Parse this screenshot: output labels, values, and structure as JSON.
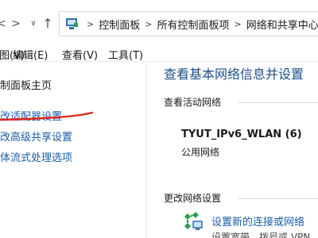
{
  "address_bar": {
    "nav": [
      "back-arrow",
      "forward-arrow",
      "dropdown",
      "up-arrow"
    ],
    "location_icon": "control-panel-icon",
    "breadcrumbs": [
      "控制面板",
      "所有控制面板项",
      "网络和共享中心"
    ]
  },
  "menubar": {
    "items": [
      "视图(V)",
      "工具(T)"
    ],
    "partial": [
      "(E)",
      "编辑(E)",
      "查看(V)"
    ]
  },
  "sidebar": {
    "title": "制面板主页",
    "links": [
      "改适配器设置",
      "改高级共享设置",
      "体流式处理选项"
    ]
  },
  "annotation": {
    "color": "#e0261d"
  },
  "main": {
    "title": "查看基本网络信息并设置",
    "active_section": "查看活动网络",
    "network": {
      "name": "TYUT_IPv6_WLAN  (6)",
      "type": "公用网络"
    },
    "change_section": "更改网络设置",
    "action": {
      "label": "设置新的连接或网络",
      "desc": "设置宽带、拨号或 VPN"
    }
  },
  "colors": {
    "link": "#1a5ca8",
    "title": "#1e4f8a"
  }
}
